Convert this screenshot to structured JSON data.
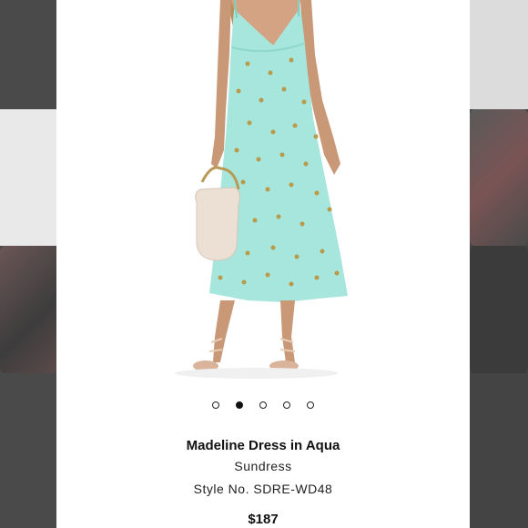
{
  "product": {
    "name": "Madeline Dress in Aqua",
    "category": "Sundress",
    "style_number": "Style No. SDRE-WD48",
    "price": "$187"
  },
  "carousel": {
    "total": 5,
    "active_index": 1
  },
  "colors": {
    "dress": "#a6e6dc",
    "dot_active": "#111111",
    "card_bg": "#ffffff",
    "backdrop": "#3a3a3a"
  }
}
